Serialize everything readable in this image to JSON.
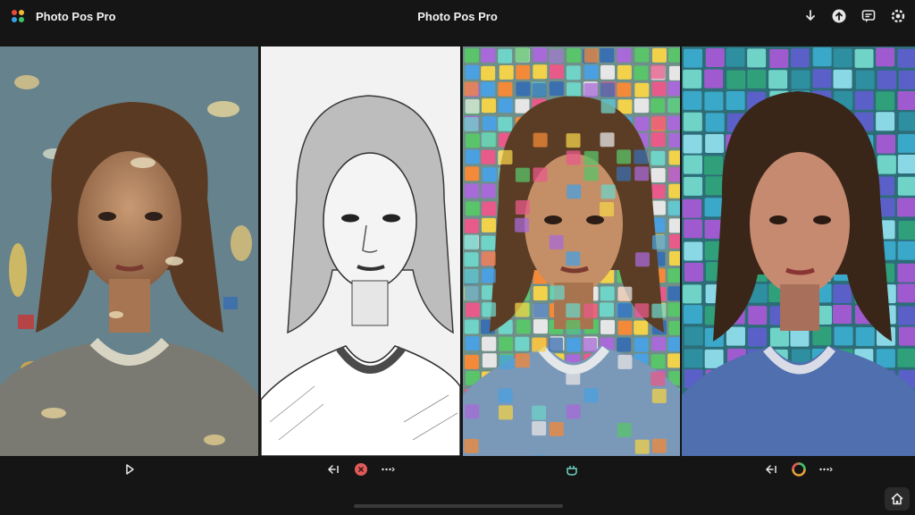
{
  "app": {
    "name": "Photo Pos Pro",
    "window_title": "Photo Pos Pro"
  },
  "titlebar_icons": [
    "download-icon",
    "upload-icon",
    "comment-icon",
    "settings-icon"
  ],
  "panels": [
    {
      "style": "oil-painting",
      "toolbar": [
        "play-icon"
      ]
    },
    {
      "style": "pencil-sketch",
      "toolbar": [
        "undo-icon",
        "reject-icon",
        "more-icon"
      ]
    },
    {
      "style": "colorful-mosaic",
      "toolbar": [
        "pot-icon"
      ]
    },
    {
      "style": "stained-glass-mosaic",
      "toolbar": [
        "undo-icon",
        "color-wheel-icon",
        "more-icon"
      ]
    }
  ],
  "colors": {
    "background": "#151515",
    "accent_red": "#e05a5a",
    "accent_teal": "#6fd3c8"
  }
}
